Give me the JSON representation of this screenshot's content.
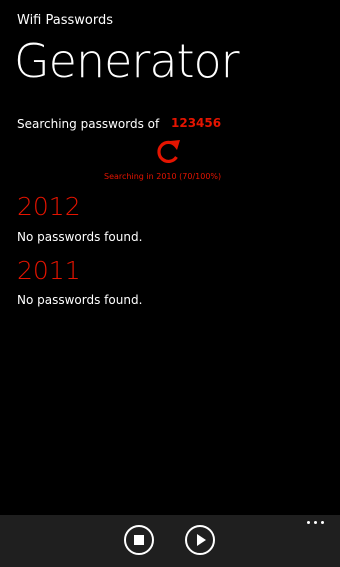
{
  "app": {
    "title": "Wifi Passwords"
  },
  "page": {
    "title": "Generator"
  },
  "search": {
    "label": "Searching passwords of",
    "term": "123456",
    "progress": "Searching in 2010 (70/100%)",
    "progress_icon": "refresh-icon"
  },
  "results": [
    {
      "year": "2012",
      "status": "No passwords found."
    },
    {
      "year": "2011",
      "status": "No passwords found."
    }
  ],
  "app_bar": {
    "buttons": [
      {
        "name": "stop",
        "icon": "stop-icon"
      },
      {
        "name": "play",
        "icon": "play-icon"
      }
    ],
    "more_icon": "more-icon"
  },
  "colors": {
    "accent": "#e51400",
    "background": "#000000",
    "app_bar": "#1f1f1f",
    "text": "#ffffff"
  }
}
